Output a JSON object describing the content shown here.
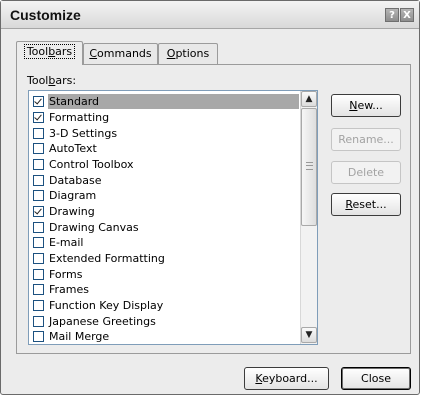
{
  "window": {
    "title": "Customize",
    "help_glyph": "?",
    "close_glyph": "X"
  },
  "tabs": [
    {
      "pre": "Tool",
      "key": "b",
      "post": "ars",
      "active": true
    },
    {
      "pre": "",
      "key": "C",
      "post": "ommands",
      "active": false
    },
    {
      "pre": "",
      "key": "O",
      "post": "ptions",
      "active": false
    }
  ],
  "toolbars": {
    "label_pre": "Tool",
    "label_key": "b",
    "label_post": "ars:",
    "items": [
      {
        "label": "Standard",
        "checked": true,
        "selected": true
      },
      {
        "label": "Formatting",
        "checked": true,
        "selected": false
      },
      {
        "label": "3-D Settings",
        "checked": false,
        "selected": false
      },
      {
        "label": "AutoText",
        "checked": false,
        "selected": false
      },
      {
        "label": "Control Toolbox",
        "checked": false,
        "selected": false
      },
      {
        "label": "Database",
        "checked": false,
        "selected": false
      },
      {
        "label": "Diagram",
        "checked": false,
        "selected": false
      },
      {
        "label": "Drawing",
        "checked": true,
        "selected": false
      },
      {
        "label": "Drawing Canvas",
        "checked": false,
        "selected": false
      },
      {
        "label": "E-mail",
        "checked": false,
        "selected": false
      },
      {
        "label": "Extended Formatting",
        "checked": false,
        "selected": false
      },
      {
        "label": "Forms",
        "checked": false,
        "selected": false
      },
      {
        "label": "Frames",
        "checked": false,
        "selected": false
      },
      {
        "label": "Function Key Display",
        "checked": false,
        "selected": false
      },
      {
        "label": "Japanese Greetings",
        "checked": false,
        "selected": false
      },
      {
        "label": "Mail Merge",
        "checked": false,
        "selected": false
      }
    ]
  },
  "buttons": {
    "new": {
      "pre": "",
      "key": "N",
      "post": "ew...",
      "enabled": true
    },
    "rename": {
      "label": "Rename...",
      "enabled": false
    },
    "delete": {
      "label": "Delete",
      "enabled": false
    },
    "reset": {
      "pre": "",
      "key": "R",
      "post": "eset...",
      "enabled": true
    },
    "keyboard": {
      "pre": "",
      "key": "K",
      "post": "eyboard...",
      "enabled": true
    },
    "close": {
      "label": "Close",
      "enabled": true
    }
  },
  "scrollbar": {
    "up_glyph": "▲",
    "down_glyph": "▼"
  }
}
